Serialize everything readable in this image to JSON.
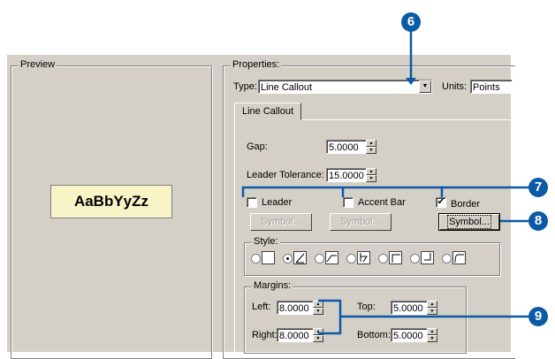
{
  "preview": {
    "group_label": "Preview",
    "sample_text": "AaBbYyZz"
  },
  "properties": {
    "group_label": "Properties:",
    "type_label": "Type:",
    "type_value": "Line Callout",
    "units_label": "Units:",
    "units_value": "Points",
    "tab_label": "Line Callout",
    "gap_label": "Gap:",
    "gap_value": "5.0000",
    "leader_tolerance_label": "Leader Tolerance:",
    "leader_tolerance_value": "15.0000",
    "leader_label": "Leader",
    "leader_checked": false,
    "accent_bar_label": "Accent Bar",
    "accent_bar_checked": false,
    "border_label": "Border",
    "border_checked": true,
    "symbol_label": "Symbol...",
    "style_label": "Style:",
    "margins_label": "Margins:",
    "left_label": "Left:",
    "left_value": "8.0000",
    "right_label": "Right:",
    "right_value": "8.0000",
    "top_label": "Top:",
    "top_value": "5.0000",
    "bottom_label": "Bottom:",
    "bottom_value": "5.0000"
  },
  "callouts": [
    "6",
    "7",
    "8",
    "9"
  ],
  "colors": {
    "callout": "#0b5aa6",
    "dialog": "#d4d0c8",
    "preview_bg": "#f8f4c8"
  },
  "icons": {
    "dropdown": "chevron-down-icon",
    "spin": "spinner-arrows-icon",
    "check": "checkmark-icon"
  }
}
